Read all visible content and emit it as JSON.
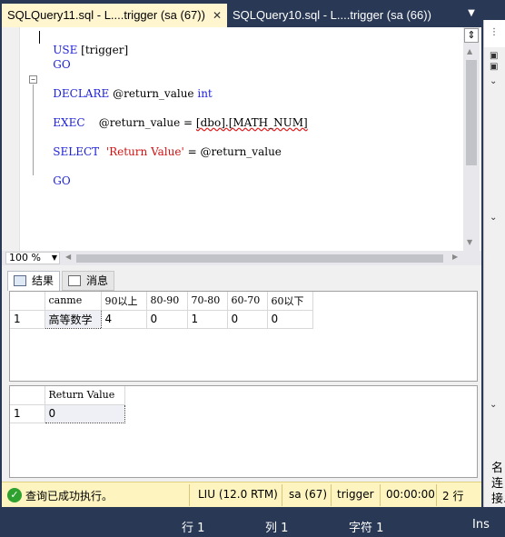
{
  "tabs": [
    {
      "label": "SQLQuery11.sql - L....trigger (sa (67))",
      "close": "✕"
    },
    {
      "label": "SQLQuery10.sql - L....trigger (sa (66))"
    }
  ],
  "editor": {
    "lines": {
      "l1_kw": "USE",
      "l1_rest": " [trigger]",
      "l2_kw": "GO",
      "l3_kw": "DECLARE",
      "l3_var": " @return_value ",
      "l3_type": "int",
      "l4_kw": "EXEC",
      "l4_var": "    @return_value = ",
      "l4_obj": "[dbo].[MATH_NUM]",
      "l5_kw": "SELECT",
      "l5_str": "  'Return Value'",
      "l5_rest": " = @return_value",
      "l6_kw": "GO"
    },
    "collapse_glyph": "−"
  },
  "zoom": {
    "value": "100 %"
  },
  "results_tabs": [
    {
      "label": "结果"
    },
    {
      "label": "消息"
    }
  ],
  "grid1": {
    "columns": [
      "canme",
      "90以上",
      "80-90",
      "70-80",
      "60-70",
      "60以下"
    ],
    "rows": [
      {
        "num": "1",
        "cells": [
          "高等数学",
          "4",
          "0",
          "1",
          "0",
          "0"
        ]
      }
    ]
  },
  "grid2": {
    "columns": [
      "Return Value"
    ],
    "rows": [
      {
        "num": "1",
        "cells": [
          "0"
        ]
      }
    ]
  },
  "status": {
    "message": "查询已成功执行。",
    "server": "LIU (12.0 RTM)",
    "user": "sa (67)",
    "database": "trigger",
    "time": "00:00:00",
    "rows": "2 行"
  },
  "bottom": {
    "line": "行 1",
    "col": "列 1",
    "ch": "字符 1",
    "mode": "Ins"
  },
  "right_panel": {
    "label1": "名",
    "label2": "连",
    "label3": "接."
  },
  "colors": {
    "keyword": "#1e22d8",
    "string": "#d21010",
    "chrome": "#293955",
    "active_tab": "#fff6d0",
    "status_bg": "#fdf4bf",
    "success": "#2fa12f"
  }
}
